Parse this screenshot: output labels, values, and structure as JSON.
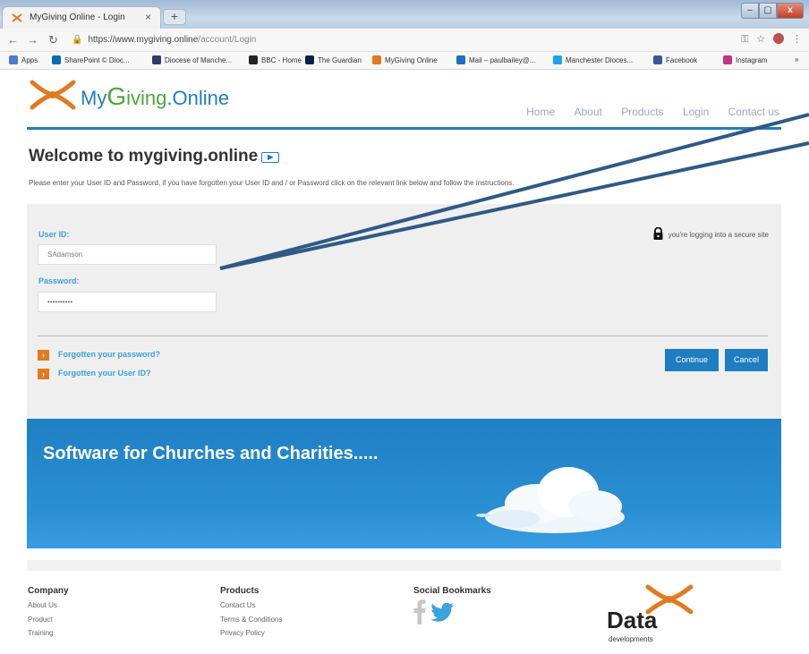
{
  "browser": {
    "tab_title": "MyGiving Online - Login",
    "tab_close": "×",
    "new_tab": "+",
    "url_domain": "https://www.mygiving.online",
    "url_path": "/account/Login",
    "window_buttons": {
      "minimize": "–",
      "maximize": "▢",
      "close": "x"
    },
    "bookmarks": [
      {
        "label": "Apps",
        "color": "#4a7bd0"
      },
      {
        "label": "SharePoint © Dioc...",
        "color": "#0a6ab8"
      },
      {
        "label": "Diocese of Manche...",
        "color": "#2b3a66"
      },
      {
        "label": "BBC - Home",
        "color": "#222222"
      },
      {
        "label": "The Guardian",
        "color": "#05204a"
      },
      {
        "label": "MyGiving Online",
        "color": "#e07a20"
      },
      {
        "label": "Mail – paulbailey@...",
        "color": "#1e6fc0"
      },
      {
        "label": "Manchester Dioces...",
        "color": "#1da1f2"
      },
      {
        "label": "Facebook",
        "color": "#3b5998"
      },
      {
        "label": "Instagram",
        "color": "#c13584"
      },
      {
        "label": "»",
        "color": ""
      }
    ]
  },
  "site": {
    "logo_my": "My",
    "logo_g": "G",
    "logo_iving": "iving",
    "logo_online": ".Online",
    "nav": [
      "Home",
      "About",
      "Products",
      "Login",
      "Contact us"
    ]
  },
  "welcome": {
    "title": "Welcome to mygiving.online",
    "video_icon": "video-icon",
    "intro": "Please enter your User ID and Password, if you have forgotten your User ID and / or Password click on the relevant link below and follow the instructions."
  },
  "login": {
    "userid_label": "User ID:",
    "userid_value": "SAdamson",
    "password_label": "Password:",
    "password_value": "••••••••••",
    "secure_text": "you're logging into a secure site",
    "forgot_password": "Forgotten your password?",
    "forgot_userid": "Forgotten your User ID?",
    "continue": "Continue",
    "cancel": "Cancel"
  },
  "banner": {
    "tagline": "Software for Churches and Charities....."
  },
  "footer": {
    "company": {
      "heading": "Company",
      "links": [
        "About Us",
        "Product",
        "Training"
      ]
    },
    "products": {
      "heading": "Products",
      "links": [
        "Contact Us",
        "Terms & Conditions",
        "Privacy Policy"
      ]
    },
    "social": {
      "heading": "Social Bookmarks",
      "icons": [
        "facebook-icon",
        "twitter-icon"
      ]
    },
    "dd_logo": {
      "word": "Data",
      "sub": "developments"
    }
  },
  "colors": {
    "brand_blue": "#1e7ec0",
    "brand_green": "#4aa838",
    "brand_orange": "#e07a20",
    "link_blue": "#39a0dc"
  }
}
